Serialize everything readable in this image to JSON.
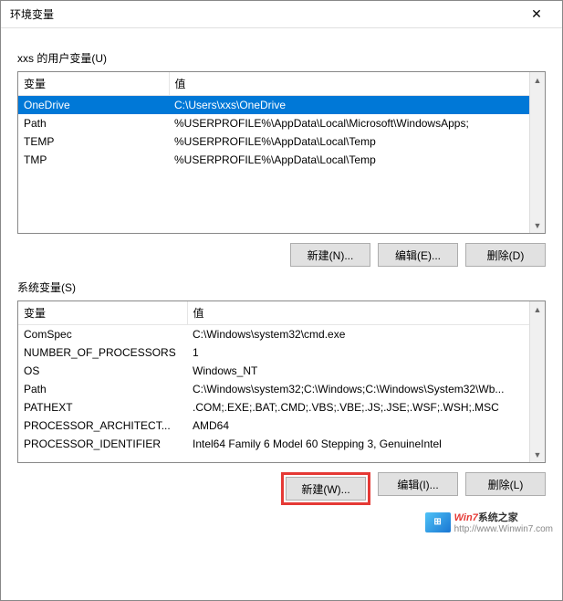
{
  "title": "环境变量",
  "user_section_label": "xxs 的用户变量(U)",
  "system_section_label": "系统变量(S)",
  "columns": {
    "var": "变量",
    "val": "值"
  },
  "user_vars": [
    {
      "name": "OneDrive",
      "value": "C:\\Users\\xxs\\OneDrive",
      "selected": true
    },
    {
      "name": "Path",
      "value": "%USERPROFILE%\\AppData\\Local\\Microsoft\\WindowsApps;",
      "selected": false
    },
    {
      "name": "TEMP",
      "value": "%USERPROFILE%\\AppData\\Local\\Temp",
      "selected": false
    },
    {
      "name": "TMP",
      "value": "%USERPROFILE%\\AppData\\Local\\Temp",
      "selected": false
    }
  ],
  "system_vars": [
    {
      "name": "ComSpec",
      "value": "C:\\Windows\\system32\\cmd.exe"
    },
    {
      "name": "NUMBER_OF_PROCESSORS",
      "value": "1"
    },
    {
      "name": "OS",
      "value": "Windows_NT"
    },
    {
      "name": "Path",
      "value": "C:\\Windows\\system32;C:\\Windows;C:\\Windows\\System32\\Wb..."
    },
    {
      "name": "PATHEXT",
      "value": ".COM;.EXE;.BAT;.CMD;.VBS;.VBE;.JS;.JSE;.WSF;.WSH;.MSC"
    },
    {
      "name": "PROCESSOR_ARCHITECT...",
      "value": "AMD64"
    },
    {
      "name": "PROCESSOR_IDENTIFIER",
      "value": "Intel64 Family 6 Model 60 Stepping 3, GenuineIntel"
    }
  ],
  "buttons": {
    "user_new": "新建(N)...",
    "user_edit": "编辑(E)...",
    "user_delete": "删除(D)",
    "sys_new": "新建(W)...",
    "sys_edit": "编辑(I)...",
    "sys_delete": "删除(L)"
  },
  "watermark": {
    "brand1": "Win7",
    "brand2": "系统之家",
    "url": "http://www.Winwin7.com"
  }
}
